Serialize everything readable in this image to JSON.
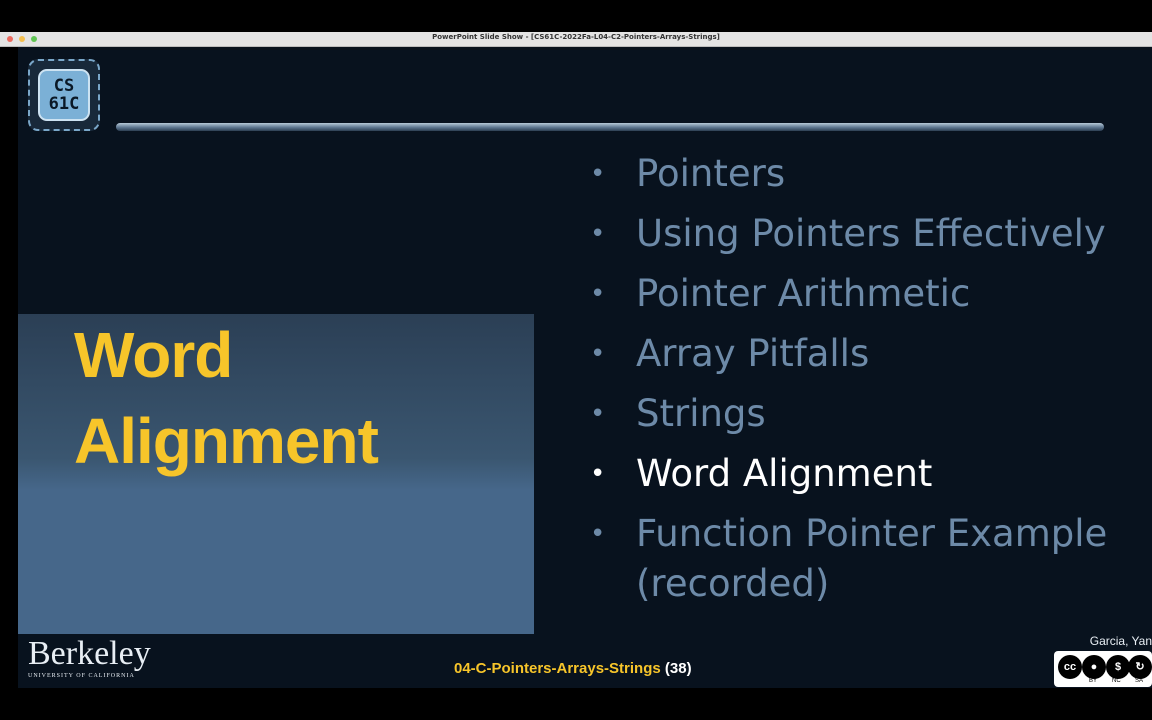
{
  "window": {
    "title": "PowerPoint Slide Show - [CS61C-2022Fa-L04-C2-Pointers-Arrays-Strings]"
  },
  "logo": {
    "line1": "CS",
    "line2": "61C"
  },
  "slide": {
    "title_line1": "Word",
    "title_line2": "Alignment",
    "bullet": "•",
    "agenda": [
      {
        "label": "Pointers"
      },
      {
        "label": "Using Pointers Effectively"
      },
      {
        "label": "Pointer Arithmetic"
      },
      {
        "label": "Array Pitfalls"
      },
      {
        "label": "Strings"
      },
      {
        "label": "Word Alignment"
      },
      {
        "label": "Function Pointer Example",
        "sub": "(recorded)"
      }
    ],
    "footer_lecture": "04-C-Pointers-Arrays-Strings",
    "footer_page": "(38)",
    "authors": "Garcia, Yan",
    "university": "Berkeley",
    "university_sub": "UNIVERSITY OF CALIFORNIA",
    "license": {
      "cc": "cc",
      "by": "BY",
      "nc": "NC",
      "sa": "SA"
    }
  },
  "colors": {
    "accent": "#f7c52a",
    "inactive": "#6d8aa8",
    "active": "#ffffff",
    "panel": "#46678a"
  }
}
